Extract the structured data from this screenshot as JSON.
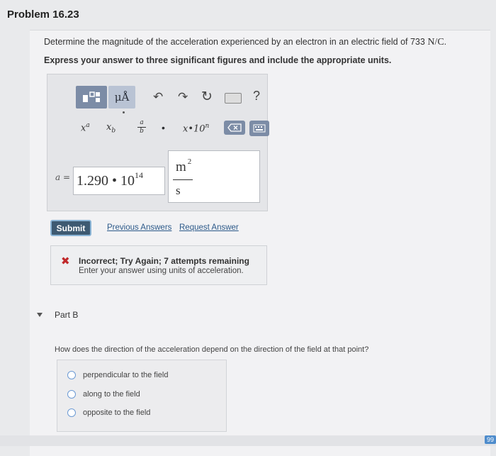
{
  "problem": {
    "title": "Problem 16.23",
    "question_prefix": "Determine the magnitude of the acceleration experienced by an electron in an electric field of 733",
    "field_unit": "N/C",
    "question_end": ".",
    "instruction": "Express your answer to three significant figures and include the appropriate units."
  },
  "toolbar": {
    "units_label": "μÅ",
    "help_label": "?",
    "power_base": "x",
    "power_exp": "a",
    "sub_base": "x",
    "sub_index": "b",
    "frac_num": "a",
    "frac_den": "b",
    "dot_label": "•",
    "sci_label": "x•10",
    "sci_exp": "n"
  },
  "answer": {
    "variable_label": "a =",
    "value_mantissa": "1.290 • 10",
    "value_exponent": "14",
    "unit_numerator": "m",
    "unit_numerator_exp": "2",
    "unit_denominator": "s"
  },
  "actions": {
    "submit_label": "Submit",
    "previous_answers_label": "Previous Answers",
    "request_answer_label": "Request Answer"
  },
  "feedback": {
    "status": "Incorrect; Try Again; 7 attempts remaining",
    "message": "Enter your answer using units of acceleration."
  },
  "part_b": {
    "label": "Part B",
    "question": "How does the direction of the acceleration depend on the direction of the field at that point?",
    "options": [
      "perpendicular to the field",
      "along to the field",
      "opposite to the field"
    ]
  },
  "footer": {
    "page_badge": "99"
  },
  "colors": {
    "toolbar_button": "#7c8ca6",
    "submit_bg": "#3e5a72",
    "link": "#2d5a8a",
    "error": "#c0282a"
  }
}
